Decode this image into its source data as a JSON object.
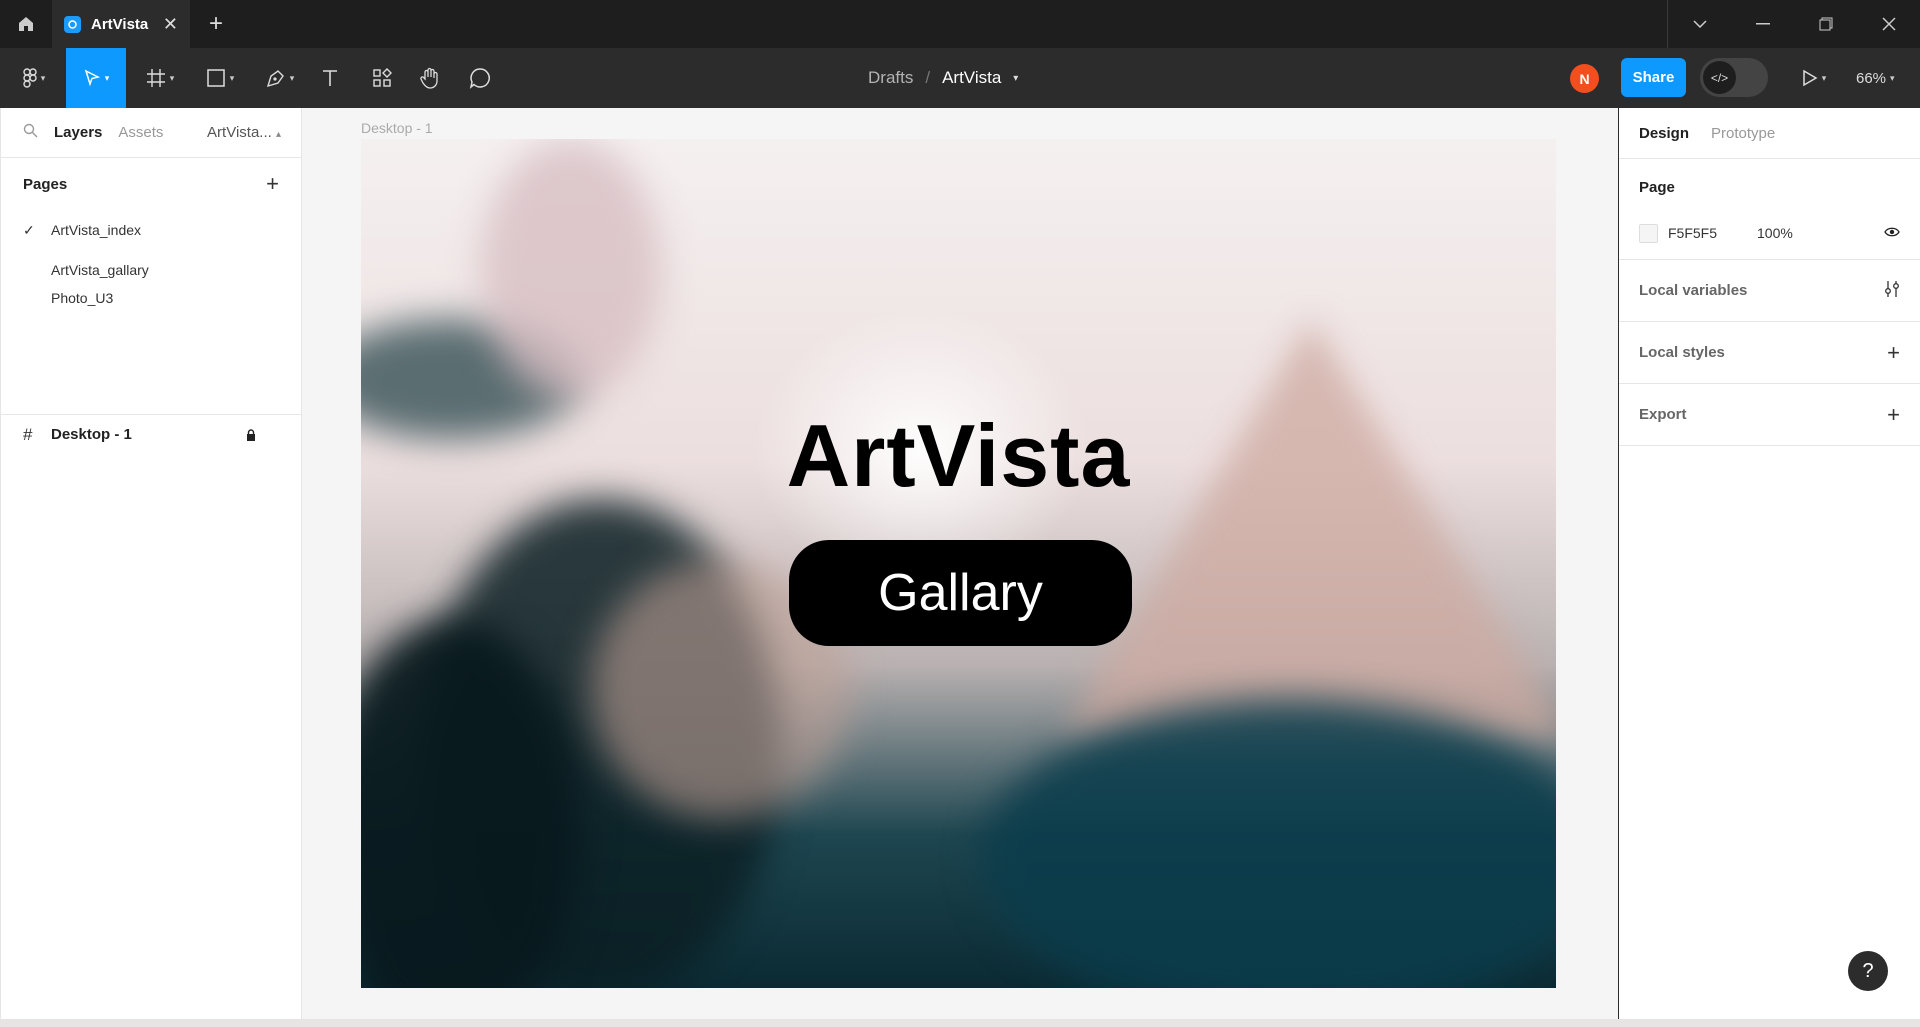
{
  "titlebar": {
    "tab_title": "ArtVista",
    "tab_close": "✕",
    "new_tab": "+",
    "icons": [
      "home-icon",
      "chevron-down-icon",
      "minimize-icon",
      "restore-icon",
      "close-icon"
    ]
  },
  "toolbar": {
    "tools": [
      "figma-menu",
      "move-tool",
      "frame-tool",
      "shape-tool",
      "pen-tool",
      "text-tool",
      "resources-tool",
      "hand-tool",
      "comment-tool"
    ],
    "breadcrumb": {
      "parent": "Drafts",
      "separator": "/",
      "file": "ArtVista"
    },
    "avatar_initial": "N",
    "share_label": "Share",
    "zoom": "66%"
  },
  "left_panel": {
    "tabs": {
      "layers": "Layers",
      "assets": "Assets",
      "file": "ArtVista..."
    },
    "pages_title": "Pages",
    "pages": [
      {
        "name": "ArtVista_index",
        "active": true
      },
      {
        "name": "ArtVista_gallary",
        "active": false
      },
      {
        "name": "Photo_U3",
        "active": false
      }
    ],
    "layers": [
      {
        "name": "Desktop - 1",
        "locked": true
      }
    ]
  },
  "canvas": {
    "frame_label": "Desktop - 1",
    "hero_title": "ArtVista",
    "button_label": "Gallary"
  },
  "right_panel": {
    "tabs": {
      "design": "Design",
      "prototype": "Prototype"
    },
    "page_section_title": "Page",
    "page_fill": {
      "hex": "F5F5F5",
      "opacity": "100%",
      "color": "#F5F5F5"
    },
    "sections": {
      "local_variables": "Local variables",
      "local_styles": "Local styles",
      "export": "Export"
    }
  },
  "help_label": "?",
  "colors": {
    "accent": "#0d99ff",
    "avatar": "#f24e1e",
    "chrome": "#2c2c2c"
  }
}
